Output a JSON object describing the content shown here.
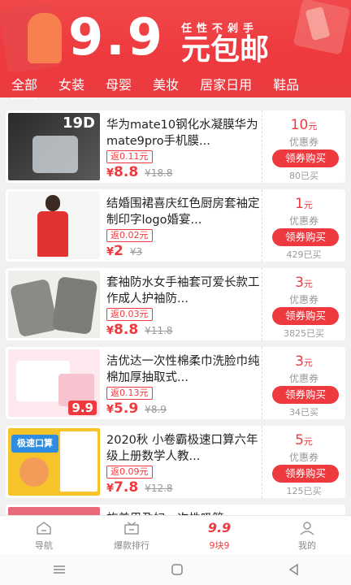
{
  "banner": {
    "big_price": "9.9",
    "slogan_small": "任性不剁手",
    "slogan_big": "元包邮"
  },
  "tabs": [
    {
      "label": "全部",
      "active": true
    },
    {
      "label": "女装",
      "active": false
    },
    {
      "label": "母婴",
      "active": false
    },
    {
      "label": "美妆",
      "active": false
    },
    {
      "label": "居家日用",
      "active": false
    },
    {
      "label": "鞋品",
      "active": false
    }
  ],
  "products": [
    {
      "title": "华为mate10钢化水凝膜华为mate9pro手机膜...",
      "rebate": "返0.11元",
      "price": "8.8",
      "original_price": "18.8",
      "coupon_amount": "10",
      "sold": "80已买",
      "thumb_text": "19D"
    },
    {
      "title": "结婚围裙喜庆红色厨房套袖定制印字logo婚宴...",
      "rebate": "返0.02元",
      "price": "2",
      "original_price": "3",
      "coupon_amount": "1",
      "sold": "429已买",
      "thumb_text": ""
    },
    {
      "title": "套袖防水女手袖套可爱长款工作成人护袖防...",
      "rebate": "返0.03元",
      "price": "8.8",
      "original_price": "11.8",
      "coupon_amount": "3",
      "sold": "3825已买",
      "thumb_text": ""
    },
    {
      "title": "洁优达一次性棉柔巾洗脸巾纯棉加厚抽取式...",
      "rebate": "返0.13元",
      "price": "5.9",
      "original_price": "8.9",
      "coupon_amount": "3",
      "sold": "34已买",
      "thumb_text": "9.9"
    },
    {
      "title": "2020秋 小卷霸极速口算六年级上册数学人教...",
      "rebate": "返0.09元",
      "price": "7.8",
      "original_price": "12.8",
      "coupon_amount": "5",
      "sold": "125已买",
      "thumb_text": "极速口算"
    },
    {
      "title": "旅美思孕妇一次性吸管...",
      "rebate": "",
      "price": "",
      "original_price": "",
      "coupon_amount": "",
      "sold": "",
      "thumb_text": ""
    }
  ],
  "coupon_unit": "元",
  "coupon_label": "优惠券",
  "coupon_button": "领券购买",
  "currency": "¥",
  "bottom_nav": [
    {
      "label": "导航",
      "icon": "home-icon",
      "active": false
    },
    {
      "label": "爆款排行",
      "icon": "ranking-icon",
      "active": false
    },
    {
      "label": "9块9",
      "icon": "nine-nine-icon",
      "active": true
    },
    {
      "label": "我的",
      "icon": "user-icon",
      "active": false
    }
  ],
  "colors": {
    "accent": "#ee3a3f",
    "banner": "#ee3a3f",
    "text": "#222222",
    "muted": "#999999"
  }
}
